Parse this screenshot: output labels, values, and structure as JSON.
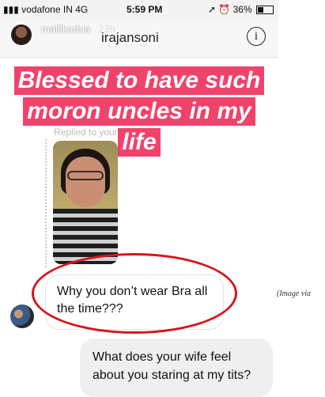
{
  "status_bar": {
    "carrier": "vodafone IN",
    "network": "4G",
    "time": "5:59 PM",
    "battery": "36%",
    "battery_level": 0.36
  },
  "story_header": {
    "username": "mallikadua",
    "age": "23h"
  },
  "header": {
    "title": "irajansoni",
    "info_icon": "info-icon"
  },
  "story_caption": {
    "lines": [
      "Blessed to have such",
      "moron uncles in my",
      "life"
    ],
    "color": "#f0436c"
  },
  "reply_note": "Replied to your story",
  "messages": {
    "incoming": {
      "line1": "Why you don’t wear Bra all",
      "line2": "the time???"
    },
    "outgoing": {
      "line1": "What does your wife feel",
      "line2": "about you staring at my tits?"
    }
  },
  "image_credit": "(Image via",
  "highlight_color": "#d7151a"
}
